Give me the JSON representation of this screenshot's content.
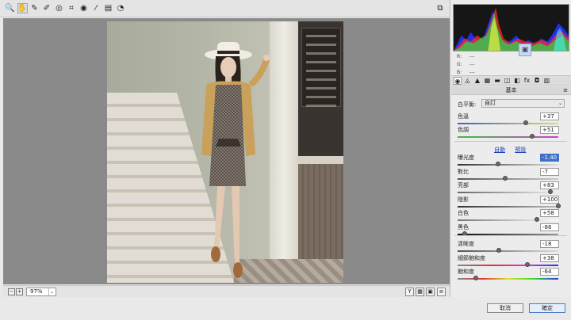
{
  "toolbar": {
    "tools": [
      {
        "name": "zoom-tool",
        "icon": "magnifier-icon",
        "glyph": "🔍"
      },
      {
        "name": "hand-tool",
        "icon": "hand-icon",
        "glyph": "✋",
        "active": true
      },
      {
        "name": "white-balance-tool",
        "icon": "eyedropper-icon",
        "glyph": "✎"
      },
      {
        "name": "color-sampler-tool",
        "icon": "color-sampler-icon",
        "glyph": "✐"
      },
      {
        "name": "targeted-adjustment-tool",
        "icon": "target-icon",
        "glyph": "◎"
      },
      {
        "name": "crop-tool",
        "icon": "crop-icon",
        "glyph": "⌗"
      },
      {
        "name": "redeye-tool",
        "icon": "eye-icon",
        "glyph": "◉"
      },
      {
        "name": "brush-tool",
        "icon": "brush-icon",
        "glyph": "⁄"
      },
      {
        "name": "preferences-tool",
        "icon": "preferences-icon",
        "glyph": "▤"
      },
      {
        "name": "rotate-tool",
        "icon": "rotate-icon",
        "glyph": "◔"
      }
    ],
    "open_preview_glyph": "⧉"
  },
  "histogram": {
    "r_label": "R:",
    "r_value": "---",
    "g_label": "G:",
    "g_value": "---",
    "b_label": "B:",
    "b_value": "---"
  },
  "panel": {
    "tabs": [
      "◉",
      "◬",
      "▲",
      "▦",
      "▬",
      "◫",
      "◧",
      "fx",
      "◘",
      "▥"
    ],
    "section_title": "基本",
    "white_balance_label": "白平衡:",
    "white_balance_value": "自訂",
    "auto_link": "自動",
    "default_link": "預設",
    "sliders_top": [
      {
        "label": "色溫",
        "value": "+37",
        "pos": 0.68
      },
      {
        "label": "色調",
        "value": "+51",
        "pos": 0.74
      }
    ],
    "sliders_mid": [
      {
        "label": "曝光度",
        "value": "-1.40",
        "pos": 0.4,
        "highlight": true
      },
      {
        "label": "對比",
        "value": "-7",
        "pos": 0.47
      },
      {
        "label": "亮部",
        "value": "+83",
        "pos": 0.92
      },
      {
        "label": "陰影",
        "value": "+100",
        "pos": 1.0
      },
      {
        "label": "白色",
        "value": "+58",
        "pos": 0.79
      },
      {
        "label": "黑色",
        "value": "-86",
        "pos": 0.07
      }
    ],
    "sliders_bottom": [
      {
        "label": "清晰度",
        "value": "-18",
        "pos": 0.41
      },
      {
        "label": "細節飽和度",
        "value": "+38",
        "pos": 0.69
      },
      {
        "label": "飽和度",
        "value": "-64",
        "pos": 0.18
      }
    ]
  },
  "bottombar": {
    "zoom_out": "−",
    "zoom_in": "+",
    "zoom_value": "97%",
    "caret": "⌄",
    "view_buttons": [
      "Y",
      "▦",
      "▣",
      "≡"
    ]
  },
  "footer": {
    "cancel_label": "取消",
    "ok_label": "確定"
  }
}
